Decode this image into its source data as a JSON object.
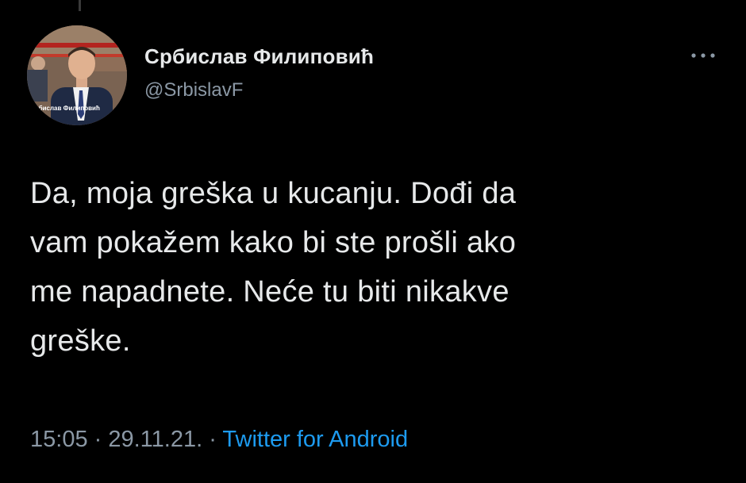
{
  "author": {
    "display_name": "Србислав Филиповић",
    "handle": "@SrbislavF",
    "avatar_caption": "Србислав Филиповић"
  },
  "tweet": {
    "text": "Da, moja greška u kucanju. Dođi da\nvam pokažem kako bi ste prošli ako\nme napadnete. Neće tu biti nikakve\ngreške."
  },
  "meta": {
    "time": "15:05",
    "separator": " · ",
    "date": "29.11.21.",
    "source": "Twitter for Android"
  },
  "icons": {
    "more": "more-horizontal-icon"
  },
  "colors": {
    "background": "#000000",
    "primary_text": "#e7e9ea",
    "secondary_text": "#8b98a5",
    "link": "#1d9bf0"
  }
}
